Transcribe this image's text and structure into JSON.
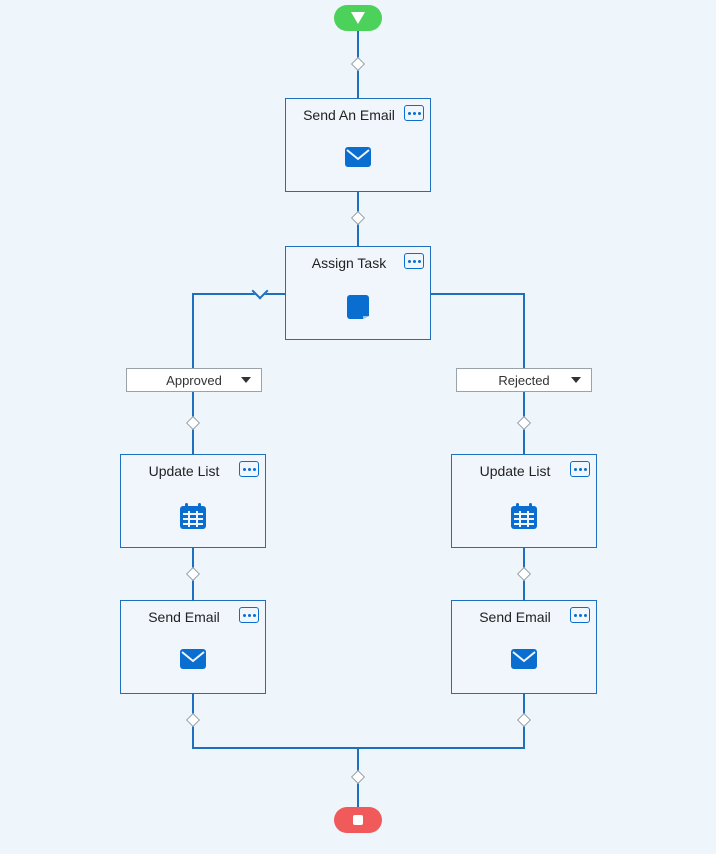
{
  "start": {
    "icon": "start-triangle"
  },
  "end": {
    "icon": "end-square"
  },
  "nodes": {
    "sendAnEmail": {
      "label": "Send An Email",
      "icon": "envelope-icon"
    },
    "assignTask": {
      "label": "Assign Task",
      "icon": "note-icon"
    },
    "updateListLeft": {
      "label": "Update List",
      "icon": "calendar-icon"
    },
    "sendEmailLeft": {
      "label": "Send Email",
      "icon": "envelope-icon"
    },
    "updateListRight": {
      "label": "Update List",
      "icon": "calendar-icon"
    },
    "sendEmailRight": {
      "label": "Send Email",
      "icon": "envelope-icon"
    }
  },
  "branches": {
    "approved": {
      "label": "Approved"
    },
    "rejected": {
      "label": "Rejected"
    }
  },
  "colors": {
    "accent": "#1e70bf",
    "start": "#4cd15a",
    "end": "#f05a5a",
    "canvas": "#eef5fb",
    "card_bg": "#f0f6fc"
  }
}
